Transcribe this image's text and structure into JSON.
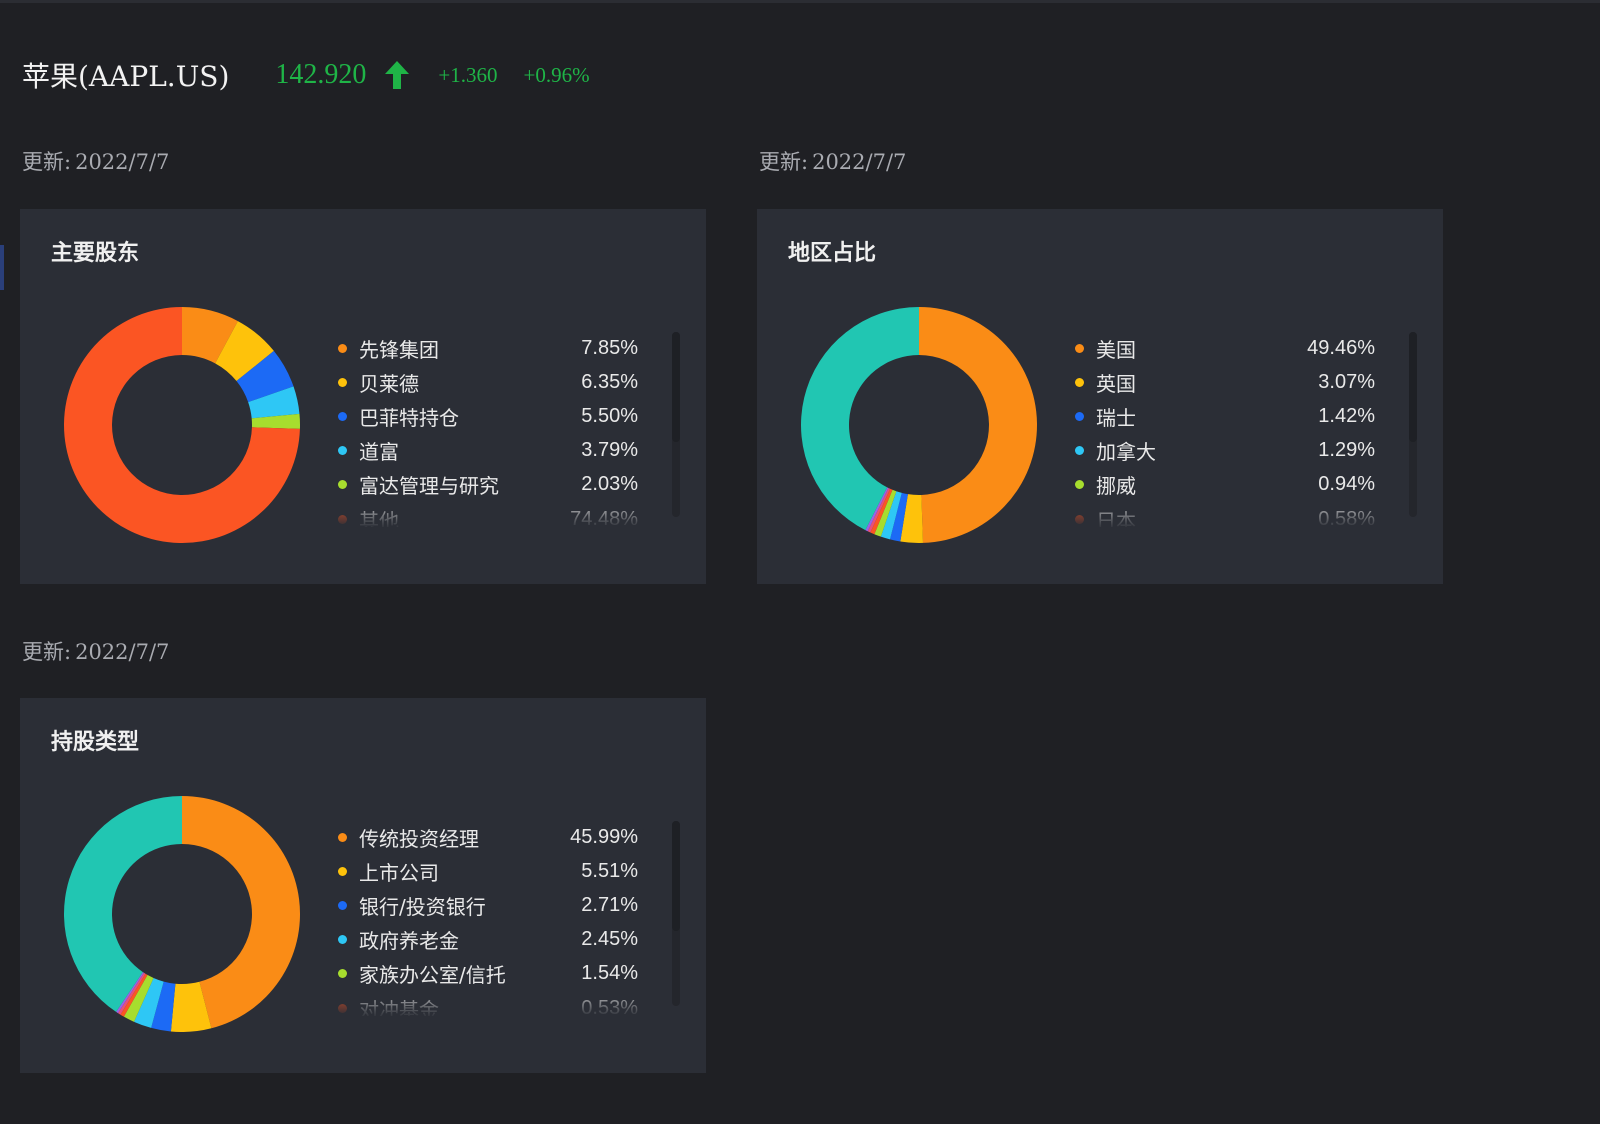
{
  "stock": {
    "name": "苹果(AAPL.US)",
    "price": "142.920",
    "change": "+1.360",
    "change_pct": "+0.96%",
    "up_color": "#1fb447",
    "arrow_icon": "arrow-up-icon"
  },
  "updates": [
    {
      "label": "更新:",
      "date": "2022/7/7"
    },
    {
      "label": "更新:",
      "date": "2022/7/7"
    },
    {
      "label": "更新:",
      "date": "2022/7/7"
    }
  ],
  "colors": [
    "#fa8c16",
    "#fec20b",
    "#1c6af5",
    "#2ec7f5",
    "#a7dd2e",
    "#fb5523",
    "#e8507a",
    "#9a63e8",
    "#21c6b2"
  ],
  "chart_data": [
    {
      "type": "pie",
      "title": "主要股东",
      "legend_position": "right",
      "slices": [
        {
          "label": "先锋集团",
          "value": 7.85,
          "display": "7.85%",
          "color": "#fa8c16"
        },
        {
          "label": "贝莱德",
          "value": 6.35,
          "display": "6.35%",
          "color": "#fec20b"
        },
        {
          "label": "巴菲特持仓",
          "value": 5.5,
          "display": "5.50%",
          "color": "#1c6af5"
        },
        {
          "label": "道富",
          "value": 3.79,
          "display": "3.79%",
          "color": "#2ec7f5"
        },
        {
          "label": "富达管理与研究",
          "value": 2.03,
          "display": "2.03%",
          "color": "#a7dd2e"
        },
        {
          "label": "其他",
          "value": 74.48,
          "display": "74.48%",
          "color": "#fb5523"
        }
      ]
    },
    {
      "type": "pie",
      "title": "地区占比",
      "legend_position": "right",
      "slices": [
        {
          "label": "美国",
          "value": 49.46,
          "display": "49.46%",
          "color": "#fa8c16"
        },
        {
          "label": "英国",
          "value": 3.07,
          "display": "3.07%",
          "color": "#fec20b"
        },
        {
          "label": "瑞士",
          "value": 1.42,
          "display": "1.42%",
          "color": "#1c6af5"
        },
        {
          "label": "加拿大",
          "value": 1.29,
          "display": "1.29%",
          "color": "#2ec7f5"
        },
        {
          "label": "挪威",
          "value": 0.94,
          "display": "0.94%",
          "color": "#a7dd2e"
        },
        {
          "label": "日本",
          "value": 0.58,
          "display": "0.58%",
          "color": "#fb5523"
        },
        {
          "value": 0.4,
          "color": "#e8507a"
        },
        {
          "value": 0.35,
          "color": "#9a63e8"
        },
        {
          "value": 42.49,
          "color": "#21c6b2"
        }
      ]
    },
    {
      "type": "pie",
      "title": "持股类型",
      "legend_position": "right",
      "slices": [
        {
          "label": "传统投资经理",
          "value": 45.99,
          "display": "45.99%",
          "color": "#fa8c16"
        },
        {
          "label": "上市公司",
          "value": 5.51,
          "display": "5.51%",
          "color": "#fec20b"
        },
        {
          "label": "银行/投资银行",
          "value": 2.71,
          "display": "2.71%",
          "color": "#1c6af5"
        },
        {
          "label": "政府养老金",
          "value": 2.45,
          "display": "2.45%",
          "color": "#2ec7f5"
        },
        {
          "label": "家族办公室/信托",
          "value": 1.54,
          "display": "1.54%",
          "color": "#a7dd2e"
        },
        {
          "label": "对冲基金",
          "value": 0.53,
          "display": "0.53%",
          "color": "#fb5523"
        },
        {
          "value": 0.4,
          "color": "#e8507a"
        },
        {
          "value": 0.3,
          "color": "#9a63e8"
        },
        {
          "value": 40.57,
          "color": "#21c6b2"
        }
      ]
    }
  ]
}
